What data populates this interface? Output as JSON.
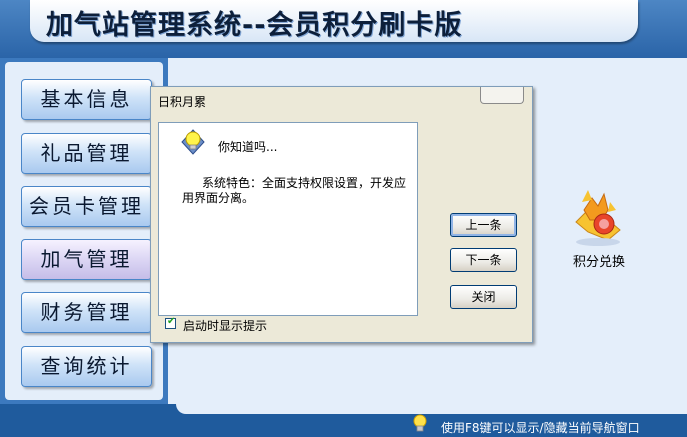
{
  "app": {
    "title": "加气站管理系统--会员积分刷卡版"
  },
  "sidebar": {
    "items": [
      {
        "label": "基本信息"
      },
      {
        "label": "礼品管理"
      },
      {
        "label": "会员卡管理"
      },
      {
        "label": "加气管理",
        "active": true
      },
      {
        "label": "财务管理"
      },
      {
        "label": "查询统计"
      }
    ]
  },
  "main": {
    "exchange_label": "积分兑换",
    "exchange_icon": "gift-exchange-icon"
  },
  "dialog": {
    "title": "日积月累",
    "close_label": "",
    "heading": "你知道吗...",
    "tip": "系统特色：全面支持权限设置，开发应用界面分离。",
    "buttons": {
      "prev": "上一条",
      "next": "下一条",
      "close": "关闭"
    },
    "show_on_startup": {
      "label": "启动时显示提示",
      "checked": true
    }
  },
  "status_bar": {
    "text": "使用F8键可以显示/隐藏当前导航窗口"
  }
}
